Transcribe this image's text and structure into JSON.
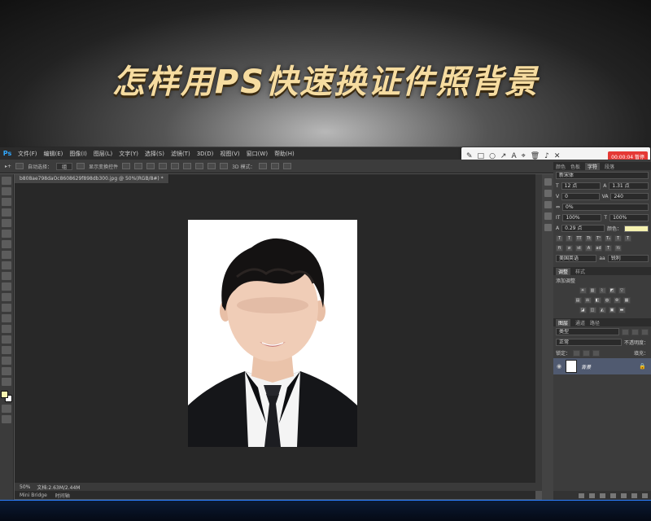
{
  "banner": {
    "title": "怎样用PS快速换证件照背景"
  },
  "app": {
    "logo": "Ps"
  },
  "menu": [
    "文件(F)",
    "编辑(E)",
    "图像(I)",
    "图层(L)",
    "文字(Y)",
    "选择(S)",
    "滤镜(T)",
    "3D(D)",
    "视图(V)",
    "窗口(W)",
    "帮助(H)"
  ],
  "options_bar": {
    "auto_select_label": "自动选择：",
    "auto_select_value": "组",
    "show_transform_label": "显示变换控件",
    "mode_3d_label": "3D 模式："
  },
  "recorder": {
    "timer": "00:00:04 暂停"
  },
  "document": {
    "tab_title": "b808ae798daOc8608629f898db300.jpg @ 50%(RGB/8#) *",
    "zoom": "50%",
    "doc_info": "文档:2.63M/2.44M"
  },
  "timeline": {
    "label": "Mini Bridge",
    "label2": "时间轴"
  },
  "character_panel": {
    "tabs": [
      "颜色",
      "色板",
      "字符",
      "段落"
    ],
    "font_family": "新宋体",
    "font_size": "12 点",
    "leading": "1.31 点",
    "kerning": "0",
    "tracking": "240",
    "vertical_scale": "0%",
    "h_scale": "100%",
    "v_scale": "100%",
    "baseline": "0.29 点",
    "color_label": "颜色：",
    "language": "美国英语",
    "antialias": "锐利"
  },
  "adjustments_panel": {
    "tabs": [
      "调整",
      "样式"
    ],
    "title": "添加调整"
  },
  "layers_panel": {
    "tabs": [
      "图层",
      "通道",
      "路径"
    ],
    "kind": "类型",
    "blend_mode": "正常",
    "opacity_label": "不透明度：",
    "lock_label": "锁定：",
    "fill_label": "填充：",
    "layer_name": "背景"
  },
  "colors": {
    "foreground": "#f6f2b0",
    "accent": "#31a8ff",
    "record": "#e53935"
  },
  "icons": [
    "pen-icon",
    "rect-icon",
    "circle-icon",
    "arrow-icon",
    "text-icon",
    "pin-icon",
    "trash-icon",
    "speaker-icon",
    "close-icon"
  ]
}
